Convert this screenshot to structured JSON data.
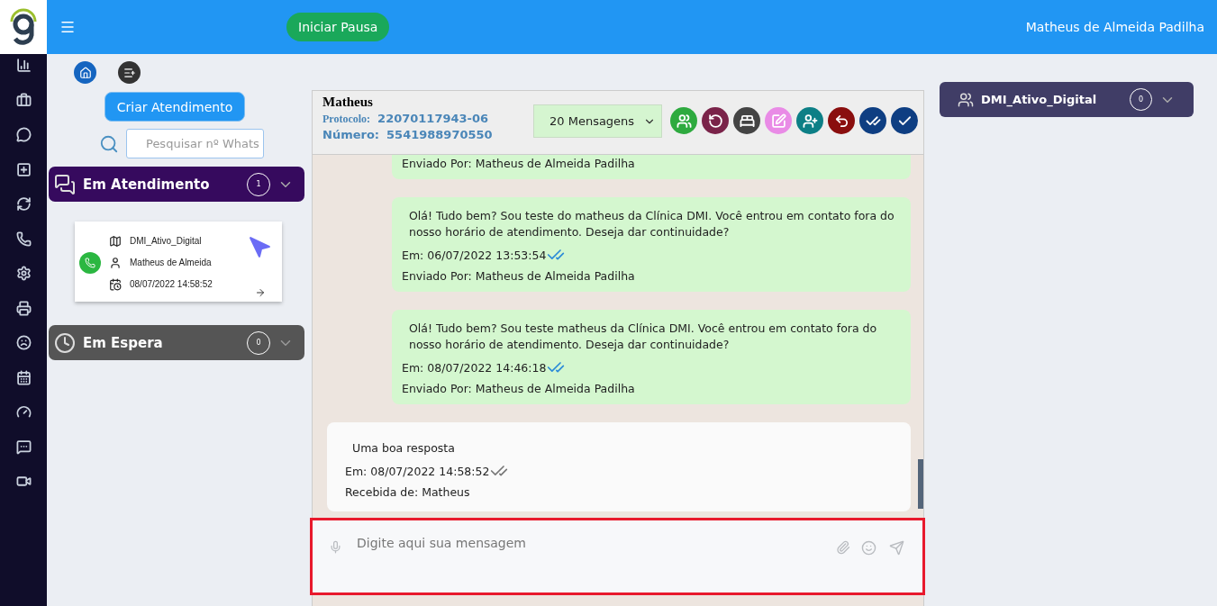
{
  "topbar": {
    "pause_button": "Iniciar Pausa",
    "user_name": "Matheus de Almeida Padilha"
  },
  "left_panel": {
    "create_button": "Criar Atendimento",
    "search": {
      "placeholder": "Pesquisar nº Whats"
    },
    "groups": [
      {
        "kind": "attending",
        "title": "Em Atendimento",
        "count": "1",
        "expanded": true,
        "cards": [
          {
            "queue": "DMI_Ativo_Digital",
            "contact": "Matheus de Almeida",
            "date": "08/07/2022 14:58:52"
          }
        ]
      },
      {
        "kind": "waiting",
        "title": "Em Espera",
        "count": "0",
        "expanded": false
      }
    ]
  },
  "chat": {
    "contact_name": "Matheus",
    "protocol_label": "Protocolo:",
    "protocol": "22070117943-06",
    "number_label": "Número:",
    "number": "5541988970550",
    "message_count": "20 Mensagens",
    "messages": [
      {
        "kind": "sent",
        "sender": "Enviado Por: Matheus de Almeida Padilha"
      },
      {
        "kind": "sent",
        "text": "Olá! Tudo bem? Sou teste do matheus da Clínica DMI. Você entrou em contato fora do nosso horário de atendimento. Deseja dar continuidade?",
        "time": "Em: 06/07/2022 13:53:54",
        "read": true,
        "sender": "Enviado Por: Matheus de Almeida Padilha"
      },
      {
        "kind": "sent",
        "text": "Olá! Tudo bem? Sou teste matheus da Clínica DMI. Você entrou em contato fora do nosso horário de atendimento. Deseja dar continuidade?",
        "time": "Em: 08/07/2022 14:46:18",
        "read": true,
        "sender": "Enviado Por: Matheus de Almeida Padilha"
      },
      {
        "kind": "received",
        "text": "Uma boa resposta",
        "time": "Em: 08/07/2022 14:58:52",
        "read": false,
        "sender": "Recebida de: Matheus"
      }
    ],
    "composer": {
      "placeholder": "Digite aqui sua mensagem"
    }
  },
  "right_panel": {
    "queue": "DMI_Ativo_Digital",
    "count": "0",
    "expanded": false
  }
}
